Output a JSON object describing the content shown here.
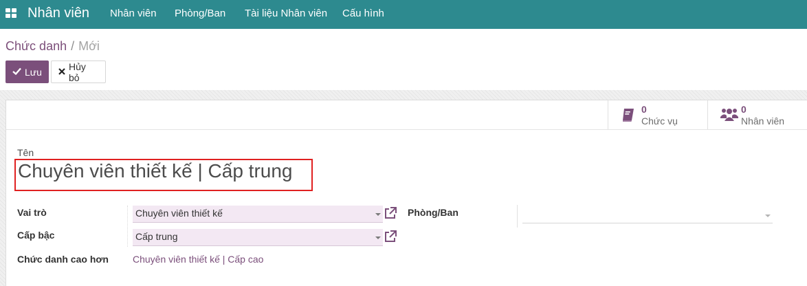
{
  "navbar": {
    "app_title": "Nhân viên",
    "menu": [
      "Nhân viên",
      "Phòng/Ban",
      "Tài liệu Nhân viên",
      "Cấu hình"
    ],
    "bg_color": "#2d8a8f"
  },
  "breadcrumb": {
    "parent": "Chức danh",
    "separator": "/",
    "current": "Mới"
  },
  "toolbar": {
    "save_label": "Lưu",
    "save_icon": "check-icon",
    "discard_label": "Hủy bỏ",
    "discard_icon": "close-icon",
    "accent_color": "#7b4f7b"
  },
  "stats": [
    {
      "value": "0",
      "label": "Chức vụ",
      "icon": "book-icon"
    },
    {
      "value": "0",
      "label": "Nhân viên",
      "icon": "users-icon"
    }
  ],
  "form": {
    "name_label": "Tên",
    "name_value": "Chuyên viên thiết kế | Cấp trung",
    "fields": {
      "role_label": "Vai trò",
      "role_value": "Chuyên viên thiết kế",
      "level_label": "Cấp bậc",
      "level_value": "Cấp trung",
      "parent_label": "Chức danh cao hơn",
      "parent_value": "Chuyên viên thiết kế | Cấp cao",
      "department_label": "Phòng/Ban",
      "department_value": ""
    }
  },
  "colors": {
    "highlight_border": "#e02020",
    "field_bg": "#f3e8f3"
  }
}
